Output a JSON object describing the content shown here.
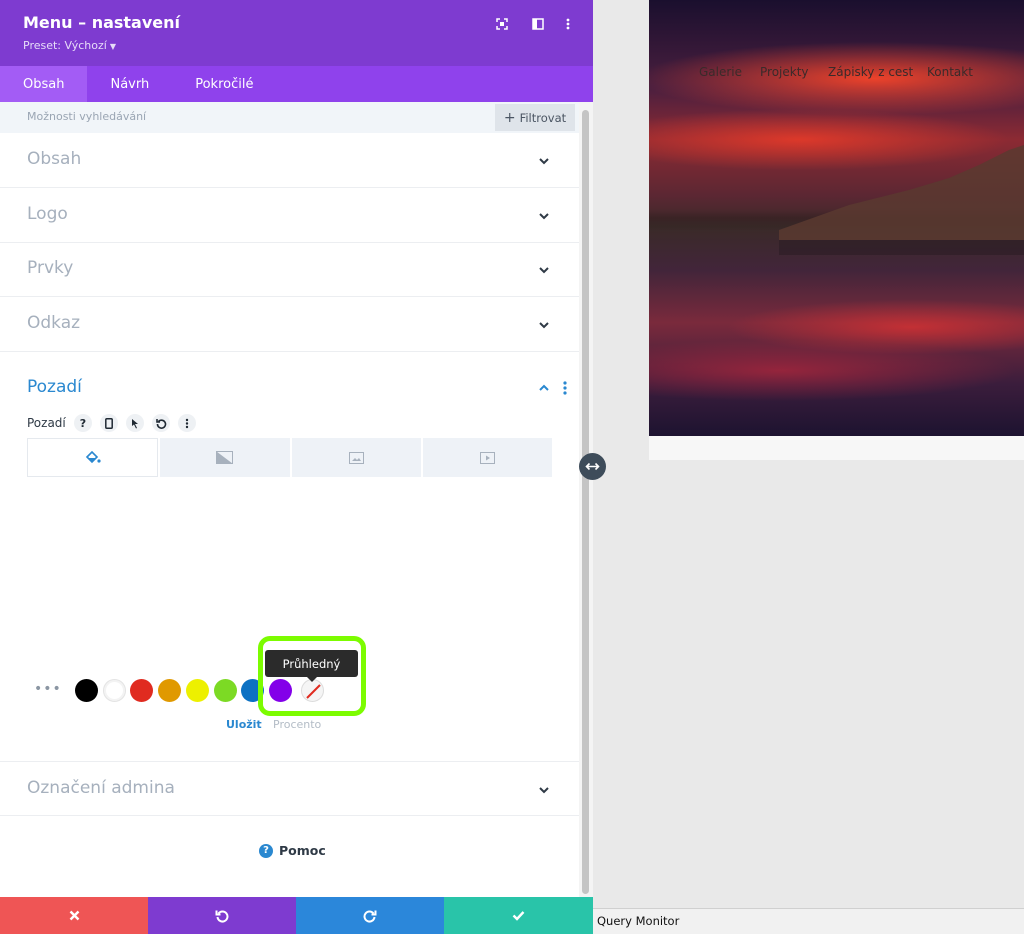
{
  "panel": {
    "title": "Menu – nastavení",
    "preset": "Preset: Výchozí",
    "accent_color": "#7e3bd0"
  },
  "tabs": [
    {
      "label": "Obsah",
      "active": true
    },
    {
      "label": "Návrh",
      "active": false
    },
    {
      "label": "Pokročilé",
      "active": false
    }
  ],
  "search": {
    "label": "Možnosti vyhledávání",
    "filter_label": "Filtrovat"
  },
  "sections": [
    {
      "label": "Obsah"
    },
    {
      "label": "Logo"
    },
    {
      "label": "Prvky"
    },
    {
      "label": "Odkaz"
    }
  ],
  "background": {
    "title": "Pozadí",
    "field_label": "Pozadí",
    "bg_tab_icons": [
      "paint-bucket-icon",
      "gradient-icon",
      "image-icon",
      "video-icon"
    ],
    "swatches": [
      {
        "name": "black",
        "color": "#000000"
      },
      {
        "name": "white",
        "color": "#ffffff"
      },
      {
        "name": "red",
        "color": "#e02b20"
      },
      {
        "name": "orange",
        "color": "#e09900"
      },
      {
        "name": "yellow",
        "color": "#edf000"
      },
      {
        "name": "green",
        "color": "#7cda24"
      },
      {
        "name": "blue",
        "color": "#0c71c3"
      },
      {
        "name": "purple",
        "color": "#8300e9"
      }
    ],
    "tooltip": "Průhledný",
    "save_label": "Uložit",
    "percent_label": "Procento"
  },
  "admin_section": {
    "label": "Označení admina"
  },
  "help_label": "Pomoc",
  "footer": {
    "colors": [
      "#ef5555",
      "#7e3bd0",
      "#2b87da",
      "#29c4a9"
    ]
  },
  "preview": {
    "nav": [
      "Galerie",
      "Projekty",
      "Zápisky z cest",
      "Kontakt"
    ]
  },
  "query_monitor": "Query Monitor"
}
